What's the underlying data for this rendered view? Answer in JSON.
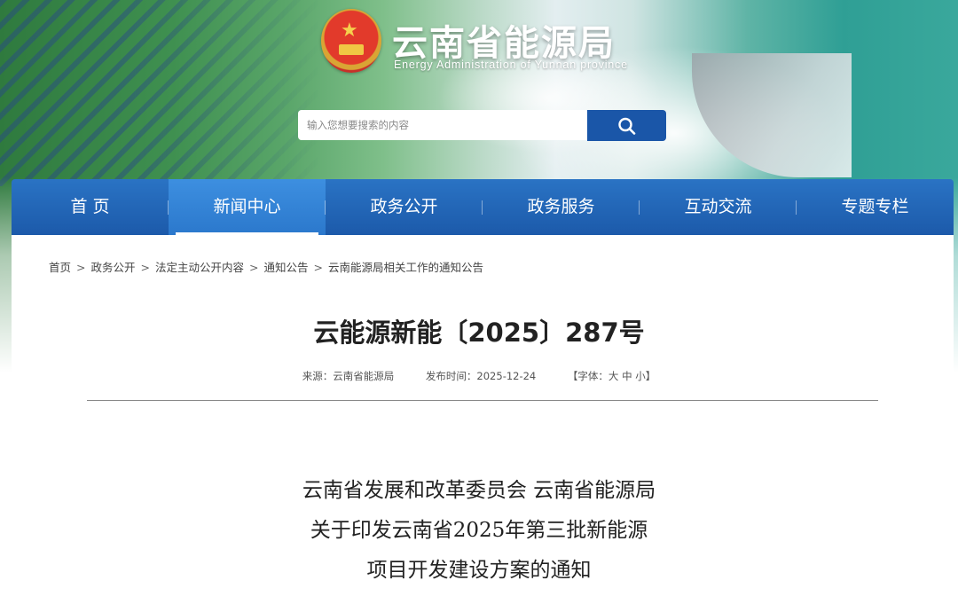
{
  "header": {
    "site_title": "云南省能源局",
    "site_subtitle": "Energy Administration of Yunnan province",
    "emblem_icon": "national-emblem-icon"
  },
  "search": {
    "placeholder": "输入您想要搜索的内容",
    "button_icon": "search-icon"
  },
  "nav": {
    "items": [
      {
        "label": "首 页"
      },
      {
        "label": "新闻中心"
      },
      {
        "label": "政务公开"
      },
      {
        "label": "政务服务"
      },
      {
        "label": "互动交流"
      },
      {
        "label": "专题专栏"
      }
    ],
    "active_index": 1
  },
  "breadcrumb": [
    "首页",
    "政务公开",
    "法定主动公开内容",
    "通知公告",
    "云南能源局相关工作的通知公告"
  ],
  "article": {
    "doc_number": "云能源新能〔2025〕287号",
    "source": "来源：云南省能源局",
    "publish_time": "发布时间：2025-12-24",
    "font_size_label": "【字体：大 中 小】",
    "heading_lines": [
      "云南省发展和改革委员会 云南省能源局",
      "关于印发云南省2025年第三批新能源",
      "项目开发建设方案的通知"
    ]
  },
  "colors": {
    "nav_blue": "#1c5aaa",
    "search_button": "#1a56a8",
    "title_text": "#222222"
  }
}
